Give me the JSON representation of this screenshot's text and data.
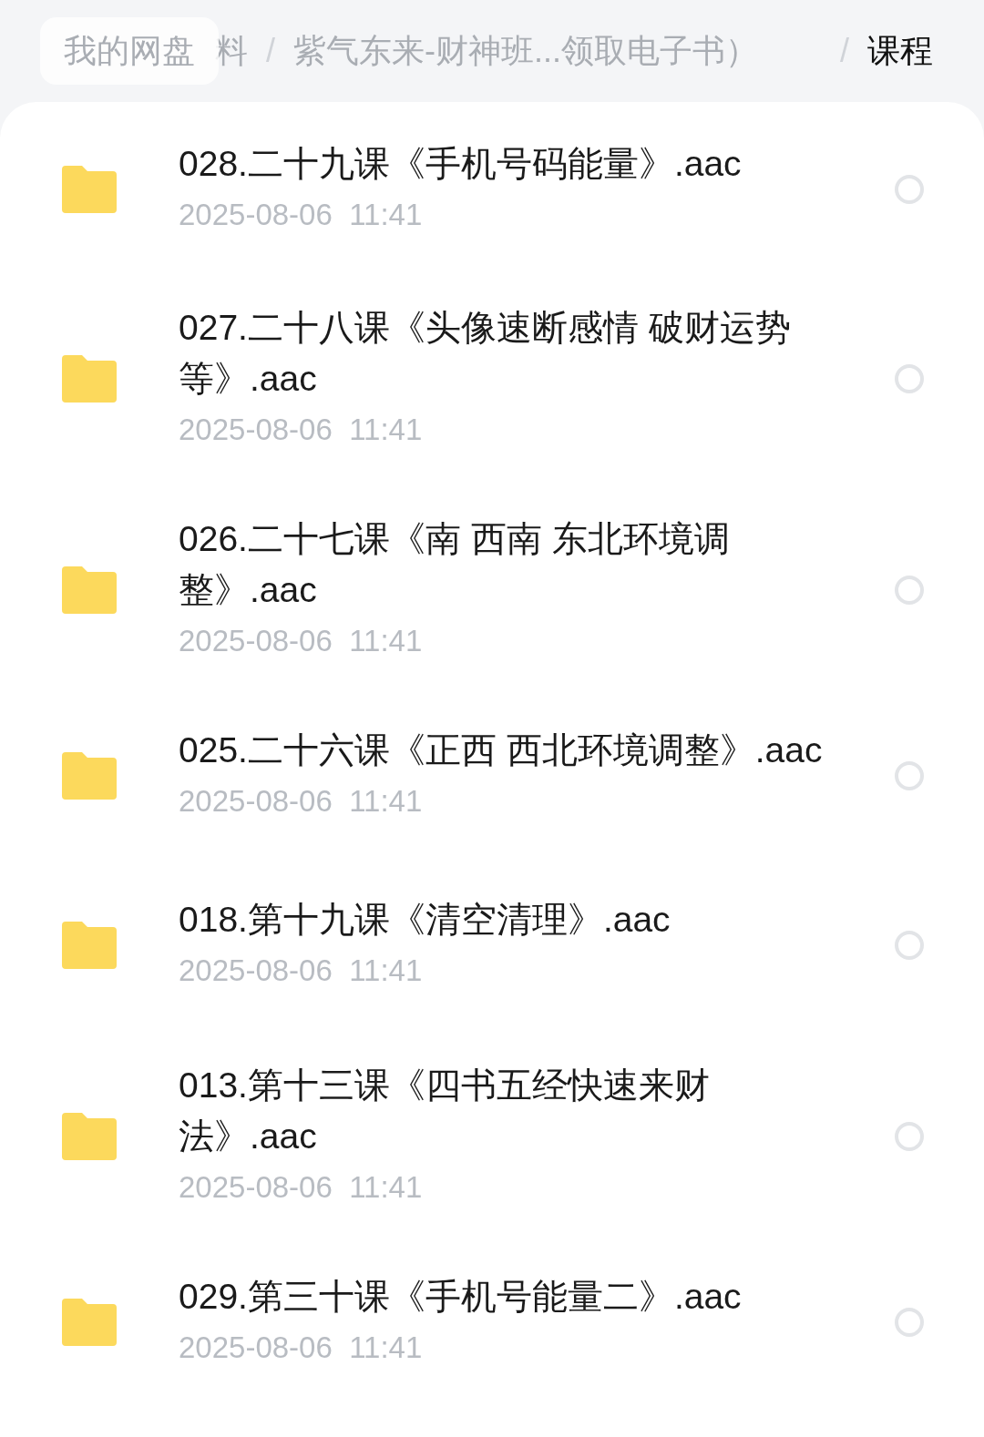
{
  "breadcrumb": {
    "root": "我的网盘",
    "separator": "/",
    "items": [
      {
        "label": "料",
        "selected": false
      },
      {
        "label": "紫气东来-财神班...领取电子书）",
        "selected": false
      },
      {
        "label": "课程",
        "selected": true
      }
    ]
  },
  "files": [
    {
      "name": "028.二十九课《手机号码能量》.aac",
      "date": "2025-08-06  11:41",
      "selected": false
    },
    {
      "name": "027.二十八课《头像速断感情 破财运势等》.aac",
      "date": "2025-08-06  11:41",
      "selected": false
    },
    {
      "name": "026.二十七课《南 西南 东北环境调整》.aac",
      "date": "2025-08-06  11:41",
      "selected": false
    },
    {
      "name": "025.二十六课《正西 西北环境调整》.aac",
      "date": "2025-08-06  11:41",
      "selected": false
    },
    {
      "name": "018.第十九课《清空清理》.aac",
      "date": "2025-08-06  11:41",
      "selected": false
    },
    {
      "name": "013.第十三课《四书五经快速来财法》.aac",
      "date": "2025-08-06  11:41",
      "selected": false
    },
    {
      "name": "029.第三十课《手机号能量二》.aac",
      "date": "2025-08-06  11:41",
      "selected": false
    }
  ]
}
